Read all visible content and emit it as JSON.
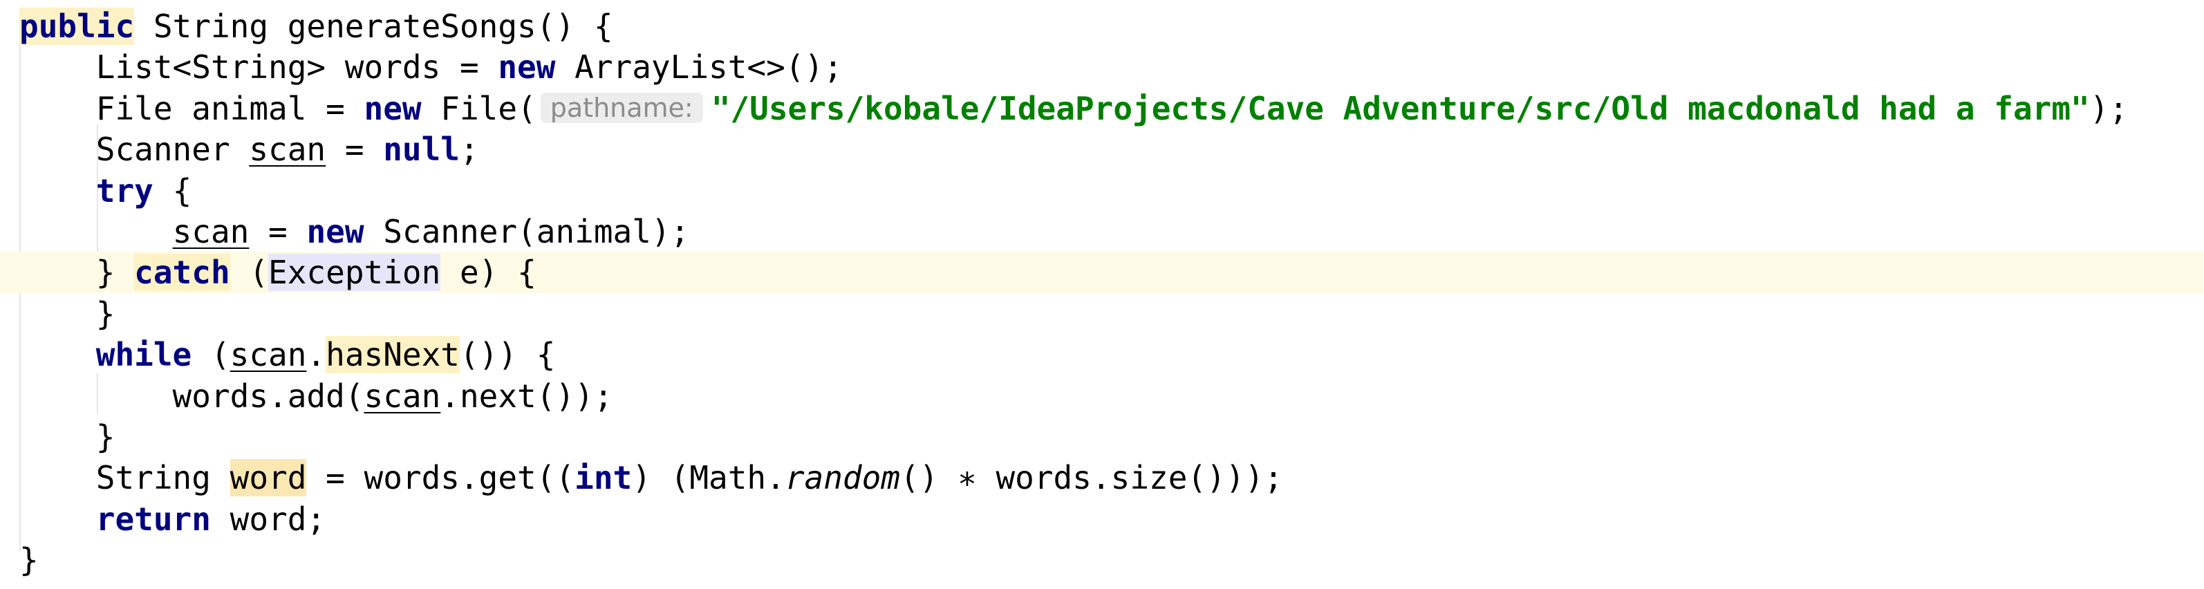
{
  "editor": {
    "lines": [
      {
        "id": "method-signature",
        "tokens": [
          {
            "type": "keyword-highlighted",
            "text": "public"
          },
          {
            "type": "plain",
            "text": " String generateSongs() {"
          }
        ]
      },
      {
        "id": "words-declaration",
        "tokens": [
          {
            "type": "plain",
            "text": "    List<String> words = "
          },
          {
            "type": "keyword",
            "text": "new"
          },
          {
            "type": "plain",
            "text": " ArrayList<>();"
          }
        ]
      },
      {
        "id": "animal-declaration",
        "tokens": [
          {
            "type": "plain",
            "text": "    File animal = "
          },
          {
            "type": "keyword",
            "text": "new"
          },
          {
            "type": "plain",
            "text": " File("
          },
          {
            "type": "hint",
            "text": "pathname:"
          },
          {
            "type": "string",
            "text": "\"/Users/"
          },
          {
            "type": "string-typo",
            "text": "kobale"
          },
          {
            "type": "string",
            "text": "/IdeaProjects/Cave Adventure/src/Old macdonald had a farm\""
          },
          {
            "type": "plain",
            "text": ");"
          }
        ]
      },
      {
        "id": "scanner-declaration",
        "tokens": [
          {
            "type": "plain",
            "text": "    Scanner "
          },
          {
            "type": "reassigned-var",
            "text": "scan"
          },
          {
            "type": "plain",
            "text": " = "
          },
          {
            "type": "keyword",
            "text": "null"
          },
          {
            "type": "plain",
            "text": ";"
          }
        ]
      },
      {
        "id": "try-open",
        "tokens": [
          {
            "type": "plain",
            "text": "    "
          },
          {
            "type": "keyword",
            "text": "try"
          },
          {
            "type": "plain",
            "text": " {"
          }
        ]
      },
      {
        "id": "scanner-assignment",
        "tokens": [
          {
            "type": "plain",
            "text": "        "
          },
          {
            "type": "reassigned-var",
            "text": "scan"
          },
          {
            "type": "plain",
            "text": " = "
          },
          {
            "type": "keyword",
            "text": "new"
          },
          {
            "type": "plain",
            "text": " Scanner(animal);"
          }
        ]
      },
      {
        "id": "catch-open",
        "current": true,
        "tokens": [
          {
            "type": "plain",
            "text": "    } "
          },
          {
            "type": "keyword-highlighted",
            "text": "catch"
          },
          {
            "type": "plain",
            "text": " ("
          },
          {
            "type": "exception-highlighted",
            "text": "Exception"
          },
          {
            "type": "plain",
            "text": " e) {"
          }
        ]
      },
      {
        "id": "catch-close",
        "tokens": [
          {
            "type": "plain",
            "text": "    }"
          }
        ]
      },
      {
        "id": "while-open",
        "tokens": [
          {
            "type": "plain",
            "text": "    "
          },
          {
            "type": "keyword",
            "text": "while"
          },
          {
            "type": "plain",
            "text": " ("
          },
          {
            "type": "reassigned-var",
            "text": "scan"
          },
          {
            "type": "plain",
            "text": "."
          },
          {
            "type": "method-highlighted",
            "text": "hasNext"
          },
          {
            "type": "plain",
            "text": "()) {"
          }
        ]
      },
      {
        "id": "words-add",
        "tokens": [
          {
            "type": "plain",
            "text": "        words.add("
          },
          {
            "type": "reassigned-var",
            "text": "scan"
          },
          {
            "type": "plain",
            "text": ".next());"
          }
        ]
      },
      {
        "id": "while-close",
        "tokens": [
          {
            "type": "plain",
            "text": "    }"
          }
        ]
      },
      {
        "id": "word-declaration",
        "tokens": [
          {
            "type": "plain",
            "text": "    String "
          },
          {
            "type": "word-highlighted",
            "text": "word"
          },
          {
            "type": "plain",
            "text": " = words.get(("
          },
          {
            "type": "keyword",
            "text": "int"
          },
          {
            "type": "plain",
            "text": ") (Math."
          },
          {
            "type": "static-call",
            "text": "random"
          },
          {
            "type": "plain",
            "text": "() ∗ words.size()));"
          }
        ]
      },
      {
        "id": "return-statement",
        "tokens": [
          {
            "type": "plain",
            "text": "    "
          },
          {
            "type": "keyword",
            "text": "return"
          },
          {
            "type": "plain",
            "text": " word;"
          }
        ]
      },
      {
        "id": "method-close",
        "tokens": [
          {
            "type": "plain",
            "text": "}"
          }
        ]
      }
    ]
  },
  "colors": {
    "keyword": "#000080",
    "string": "#008000",
    "hint_text": "#8c8c8c",
    "hint_background": "#ededed",
    "current_line": "#fdfbe6",
    "identifier_highlight": "#fdf1c6",
    "exception_highlight": "#e6e6fb"
  }
}
